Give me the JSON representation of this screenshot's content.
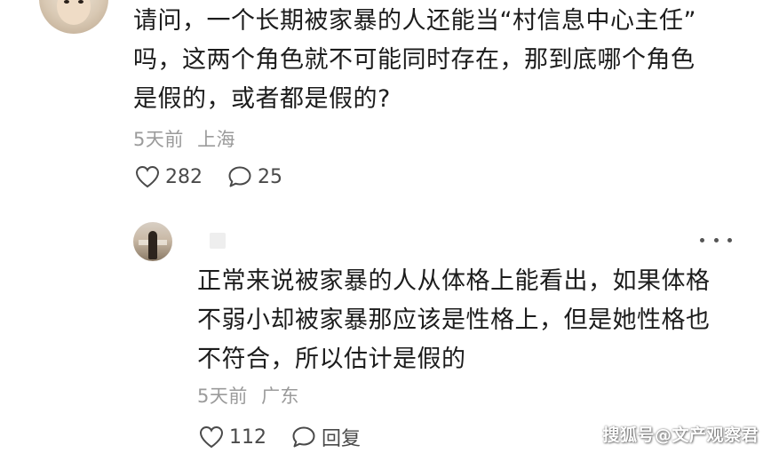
{
  "top_comment": {
    "lines": [
      "请问，一个长期被家暴的人还能当“村信息中心主任”",
      "吗，这两个角色就不可能同时存在，那到底哪个角色",
      "是假的，或者都是假的?"
    ],
    "time": "5天前",
    "location": "上海",
    "likes": "282",
    "comments": "25",
    "avatar_icon": "user-avatar",
    "like_icon": "heart-icon",
    "comment_icon": "comment-bubble-icon"
  },
  "reply": {
    "lines": [
      "正常来说被家暴的人从体格上能看出，如果体格",
      "不弱小却被家暴那应该是性格上，但是她性格也",
      "不符合，所以估计是假的"
    ],
    "time": "5天前",
    "location": "广东",
    "likes": "112",
    "reply_label": "回复",
    "more_icon": "more-dots-icon"
  },
  "watermark": "搜狐号@文产观察君"
}
